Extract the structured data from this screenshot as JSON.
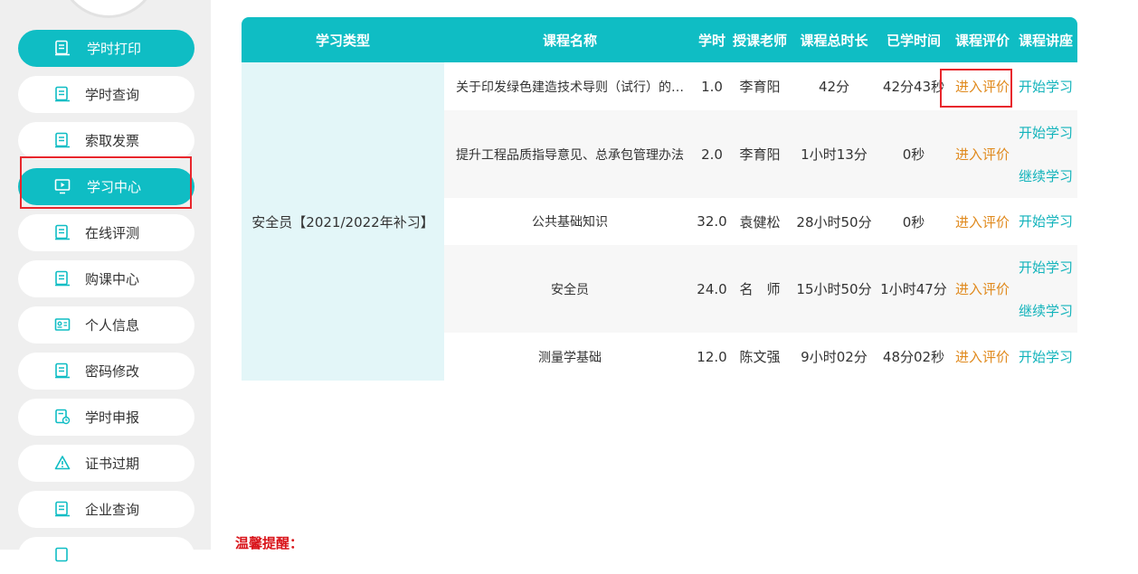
{
  "sidebar": {
    "items": [
      {
        "label": "学时打印",
        "icon": "document-icon"
      },
      {
        "label": "学时查询",
        "icon": "document-icon"
      },
      {
        "label": "索取发票",
        "icon": "document-icon"
      },
      {
        "label": "学习中心",
        "icon": "play-screen-icon"
      },
      {
        "label": "在线评测",
        "icon": "document-icon"
      },
      {
        "label": "购课中心",
        "icon": "document-icon"
      },
      {
        "label": "个人信息",
        "icon": "id-card-icon"
      },
      {
        "label": "密码修改",
        "icon": "document-icon"
      },
      {
        "label": "学时申报",
        "icon": "document-clock-icon"
      },
      {
        "label": "证书过期",
        "icon": "warning-icon"
      },
      {
        "label": "企业查询",
        "icon": "document-icon"
      }
    ]
  },
  "table": {
    "headers": {
      "type": "学习类型",
      "name": "课程名称",
      "hours": "学时",
      "teacher": "授课老师",
      "total": "课程总时长",
      "studied": "已学时间",
      "eval": "课程评价",
      "lecture": "课程讲座"
    },
    "study_type": "安全员【2021/2022年补习】",
    "rows": [
      {
        "name": "关于印发绿色建造技术导则（试行）的通知",
        "hours": "1.0",
        "teacher": "李育阳",
        "total": "42分",
        "studied": "42分43秒",
        "eval": "进入评价",
        "actions": [
          "开始学习"
        ]
      },
      {
        "name": "提升工程品质指导意见、总承包管理办法",
        "hours": "2.0",
        "teacher": "李育阳",
        "total": "1小时13分",
        "studied": "0秒",
        "eval": "进入评价",
        "actions": [
          "开始学习",
          "继续学习"
        ]
      },
      {
        "name": "公共基础知识",
        "hours": "32.0",
        "teacher": "袁健松",
        "total": "28小时50分",
        "studied": "0秒",
        "eval": "进入评价",
        "actions": [
          "开始学习"
        ]
      },
      {
        "name": "安全员",
        "hours": "24.0",
        "teacher": "名　师",
        "total": "15小时50分",
        "studied": "1小时47分",
        "eval": "进入评价",
        "actions": [
          "开始学习",
          "继续学习"
        ]
      },
      {
        "name": "测量学基础",
        "hours": "12.0",
        "teacher": "陈文强",
        "total": "9小时02分",
        "studied": "48分02秒",
        "eval": "进入评价",
        "actions": [
          "开始学习"
        ]
      }
    ]
  },
  "reminder": "温馨提醒：",
  "colors": {
    "accent": "#0fbdc4",
    "eval_link": "#e08a1e",
    "study_link": "#12b3bb",
    "highlight": "#e8262c",
    "reminder": "#d9141a"
  }
}
